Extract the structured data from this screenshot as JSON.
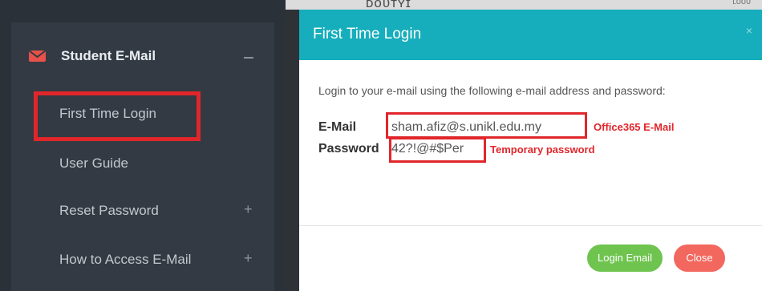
{
  "sidebar": {
    "section": {
      "label": "Student E-Mail",
      "icon": "envelope-icon",
      "collapse_symbol": "−"
    },
    "items": [
      {
        "label": "First Time Login"
      },
      {
        "label": "User Guide"
      },
      {
        "label": "Reset Password",
        "expand_symbol": "+"
      },
      {
        "label": "How to Access E-Mail",
        "expand_symbol": "+"
      }
    ]
  },
  "background": {
    "header_text": "ᴅᴏᴜᴛʏɪ",
    "header_right": "ʟᴏᴏᴜ"
  },
  "modal": {
    "title": "First Time Login",
    "close_symbol": "×",
    "intro": "Login to your e-mail using the following e-mail address and password:",
    "email": {
      "label": "E-Mail",
      "value": "sham.afiz@s.unikl.edu.my"
    },
    "password": {
      "label": "Password",
      "value": "42?!@#$Per"
    },
    "buttons": {
      "login": "Login Email",
      "close": "Close"
    }
  },
  "annotations": {
    "email_note": "Office365 E-Mail",
    "password_note": "Temporary password"
  },
  "colors": {
    "header_teal": "#16aebc",
    "login_green": "#6ec44f",
    "close_red": "#f2675e",
    "annotation_red": "#e1262b",
    "sidebar_dark": "#333a43"
  }
}
